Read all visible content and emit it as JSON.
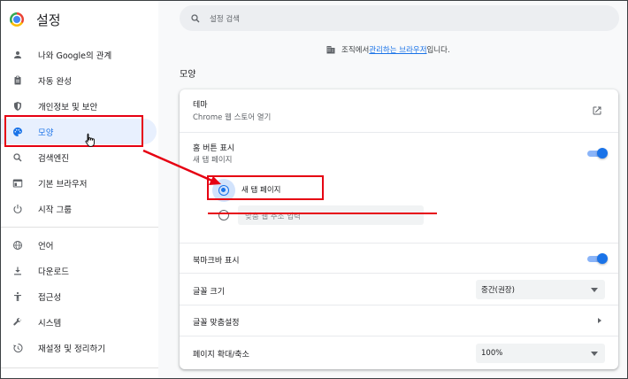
{
  "app": {
    "title": "설정"
  },
  "sidebar": {
    "items": [
      {
        "label": "나와 Google의 관계",
        "icon": "person-icon"
      },
      {
        "label": "자동 완성",
        "icon": "clipboard-icon"
      },
      {
        "label": "개인정보 및 보안",
        "icon": "shield-icon"
      },
      {
        "label": "모양",
        "icon": "palette-icon",
        "active": true
      },
      {
        "label": "검색엔진",
        "icon": "search-icon"
      },
      {
        "label": "기본 브라우저",
        "icon": "browser-icon"
      },
      {
        "label": "시작 그룹",
        "icon": "power-icon"
      },
      {
        "label": "언어",
        "icon": "globe-icon"
      },
      {
        "label": "다운로드",
        "icon": "download-icon"
      },
      {
        "label": "접근성",
        "icon": "accessibility-icon"
      },
      {
        "label": "시스템",
        "icon": "wrench-icon"
      },
      {
        "label": "재설정 및 정리하기",
        "icon": "restore-icon"
      }
    ]
  },
  "search": {
    "placeholder": "설정 검색"
  },
  "managed": {
    "prefix": "조직에서 ",
    "link": "관리하는 브라우저",
    "suffix": "입니다."
  },
  "section": {
    "title": "모양"
  },
  "theme": {
    "label": "테마",
    "sub": "Chrome 웹 스토어 열기"
  },
  "home_button": {
    "label": "홈 버튼 표시",
    "sub": "새 탭 페이지",
    "enabled": true,
    "options": [
      {
        "label": "새 탭 페이지",
        "checked": true
      },
      {
        "placeholder": "맞춤 웹 주소 입력",
        "checked": false
      }
    ]
  },
  "bookmarks_bar": {
    "label": "북마크바 표시",
    "enabled": true
  },
  "font_size": {
    "label": "글꼴 크기",
    "value": "중간(권장)"
  },
  "customize_fonts": {
    "label": "글꼴 맞춤설정"
  },
  "page_zoom": {
    "label": "페이지 확대/축소",
    "value": "100%"
  },
  "colors": {
    "accent": "#1a73e8",
    "annotation": "#e60012"
  }
}
